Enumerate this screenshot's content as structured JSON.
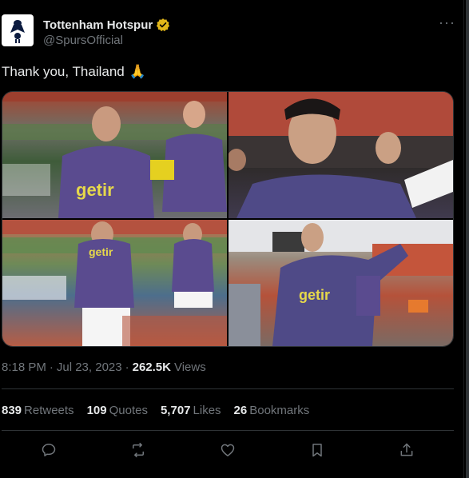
{
  "author": {
    "name": "Tottenham Hotspur",
    "handle": "@SpursOfficial",
    "verified": true
  },
  "tweet": {
    "text": "Thank you, Thailand",
    "emoji": "🙏"
  },
  "photos": [
    {
      "description_icon": "photo"
    },
    {
      "description_icon": "photo"
    },
    {
      "description_icon": "photo"
    },
    {
      "description_icon": "photo"
    }
  ],
  "meta": {
    "time": "8:18 PM",
    "dot1": "·",
    "date": "Jul 23, 2023",
    "dot2": "·",
    "views_count": "262.5K",
    "views_label": "Views"
  },
  "stats": {
    "retweets_count": "839",
    "retweets_label": "Retweets",
    "quotes_count": "109",
    "quotes_label": "Quotes",
    "likes_count": "5,707",
    "likes_label": "Likes",
    "bookmarks_count": "26",
    "bookmarks_label": "Bookmarks"
  },
  "more_menu": "···",
  "colors": {
    "background": "#000000",
    "text": "#e7e9ea",
    "muted": "#71767b",
    "verified_gold": "#e2b719",
    "border": "#2f3336"
  }
}
